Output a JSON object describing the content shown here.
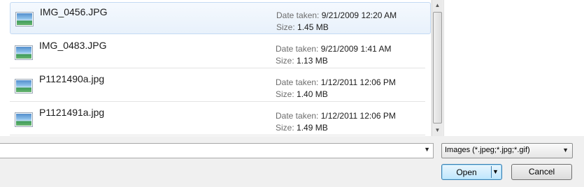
{
  "files": [
    {
      "name": "IMG_0456.JPG",
      "date_label": "Date taken:",
      "date": "9/21/2009 12:20 AM",
      "size_label": "Size:",
      "size": "1.45 MB",
      "selected": true
    },
    {
      "name": "IMG_0483.JPG",
      "date_label": "Date taken:",
      "date": "9/21/2009 1:41 AM",
      "size_label": "Size:",
      "size": "1.13 MB",
      "selected": false
    },
    {
      "name": "P1121490a.jpg",
      "date_label": "Date taken:",
      "date": "1/12/2011 12:06 PM",
      "size_label": "Size:",
      "size": "1.40 MB",
      "selected": false
    },
    {
      "name": "P1121491a.jpg",
      "date_label": "Date taken:",
      "date": "1/12/2011 12:06 PM",
      "size_label": "Size:",
      "size": "1.49 MB",
      "selected": false
    }
  ],
  "filename_input": {
    "value": ""
  },
  "file_type": {
    "selected": "Images (*.jpeg;*.jpg;*.gif)"
  },
  "buttons": {
    "open_label": "Open",
    "cancel_label": "Cancel"
  },
  "icons": {
    "thumbnail": "image-thumbnail-icon",
    "dropdown": "chevron-down-icon",
    "scroll_up": "scroll-up-icon",
    "scroll_down": "scroll-down-icon"
  },
  "colors": {
    "selection": "#e8f1fb",
    "selection_border": "#c3d9f3",
    "default_button_border": "#3c7fb1"
  }
}
